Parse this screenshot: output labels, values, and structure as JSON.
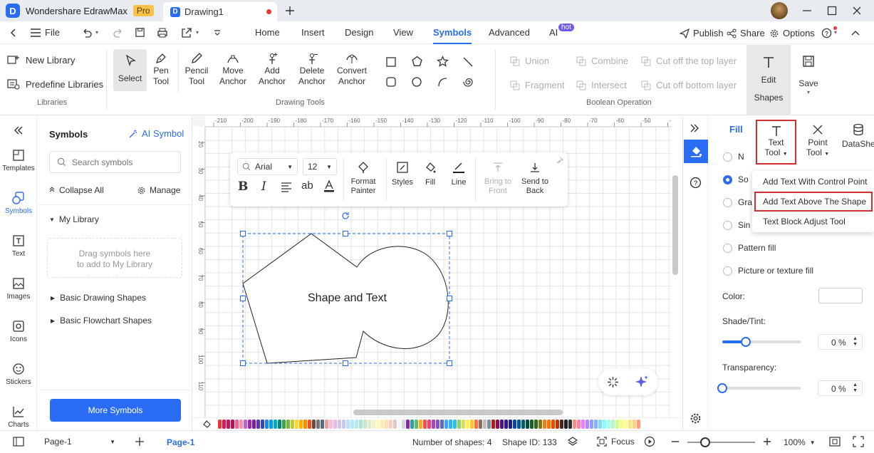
{
  "app": {
    "title": "Wondershare EdrawMax",
    "badge": "Pro",
    "doc_tab": "Drawing1"
  },
  "menu": {
    "file": "File",
    "tabs": [
      "Home",
      "Insert",
      "Design",
      "View",
      "Symbols",
      "Advanced",
      "AI"
    ],
    "ai_badge": "hot",
    "publish": "Publish",
    "share": "Share",
    "options": "Options"
  },
  "ribbon": {
    "libraries": {
      "new_library": "New Library",
      "predefine": "Predefine Libraries",
      "group": "Libraries"
    },
    "drawing": {
      "select": "Select",
      "pen": [
        "Pen",
        "Tool"
      ],
      "pencil": [
        "Pencil",
        "Tool"
      ],
      "move_anchor": [
        "Move",
        "Anchor"
      ],
      "add_anchor": [
        "Add",
        "Anchor"
      ],
      "delete_anchor": [
        "Delete",
        "Anchor"
      ],
      "convert_anchor": [
        "Convert",
        "Anchor"
      ],
      "group": "Drawing Tools"
    },
    "boolean": {
      "union": "Union",
      "combine": "Combine",
      "cut_top": "Cut off the top layer",
      "fragment": "Fragment",
      "intersect": "Intersect",
      "cut_bottom": "Cut off bottom layer",
      "group": "Boolean Operation"
    },
    "edit_shapes": [
      "Edit",
      "Shapes"
    ],
    "save": "Save"
  },
  "rail": [
    "Templates",
    "Symbols",
    "Text",
    "Images",
    "Icons",
    "Stickers",
    "Charts"
  ],
  "symbols_panel": {
    "title": "Symbols",
    "ai_symbol": "AI Symbol",
    "search_placeholder": "Search symbols",
    "collapse_all": "Collapse All",
    "manage": "Manage",
    "my_library": "My Library",
    "drop_hint": [
      "Drag symbols here",
      "to add to My Library"
    ],
    "libs": [
      "Basic Drawing Shapes",
      "Basic Flowchart Shapes"
    ],
    "more_symbols": "More Symbols"
  },
  "ruler": {
    "h": [
      "-210",
      "-200",
      "-190",
      "-180",
      "-170",
      "-160",
      "-150",
      "-140",
      "-130",
      "-120",
      "-110",
      "-100",
      "-90",
      "-80",
      "-70",
      "-60",
      "-50",
      "-40",
      "-30",
      "-20",
      "-10",
      "-4"
    ],
    "v": [
      "20",
      "30",
      "40",
      "50",
      "60",
      "70",
      "80",
      "90",
      "100",
      "110"
    ]
  },
  "floating_toolbar": {
    "font": "Arial",
    "size": "12",
    "format_painter": [
      "Format",
      "Painter"
    ],
    "styles": "Styles",
    "fill": "Fill",
    "line": "Line",
    "bring_front": [
      "Bring to",
      "Front"
    ],
    "send_back": [
      "Send to",
      "Back"
    ]
  },
  "shape_text": "Shape and Text",
  "right_panel": {
    "fill_tab": "Fill",
    "text_tool": [
      "Text",
      "Tool"
    ],
    "point_tool": [
      "Point",
      "Tool"
    ],
    "datasheet": "DataShe",
    "fill_options": [
      "N",
      "So",
      "Gra",
      "Sin",
      "Pattern fill",
      "Picture or texture fill"
    ],
    "color_label": "Color:",
    "shade_label": "Shade/Tint:",
    "shade_value": "0 %",
    "transparency_label": "Transparency:",
    "transparency_value": "0 %",
    "shade_level": 0.3,
    "transparency_level": 0
  },
  "text_menu": [
    "Add Text With Control Point",
    "Add Text Above The Shape",
    "Text Block Adjust Tool"
  ],
  "status": {
    "page_select": "Page-1",
    "page_tab": "Page-1",
    "num_shapes": "Number of shapes: 4",
    "shape_id": "Shape ID: 133",
    "focus": "Focus",
    "zoom": "100%"
  },
  "palette": [
    "#e53935",
    "#d81b60",
    "#c2185b",
    "#ad1457",
    "#f06292",
    "#f48fb1",
    "#ba68c8",
    "#9c27b0",
    "#7b1fa2",
    "#5e35b1",
    "#3949ab",
    "#1e88e5",
    "#039be5",
    "#00acc1",
    "#00897b",
    "#43a047",
    "#7cb342",
    "#c0ca33",
    "#fdd835",
    "#ffb300",
    "#fb8c00",
    "#f4511e",
    "#6d4c41",
    "#757575",
    "#546e7a",
    "#ef9a9a",
    "#f8bbd0",
    "#e1bee7",
    "#d1c4e9",
    "#c5cae9",
    "#bbdefb",
    "#b3e5fc",
    "#b2ebf2",
    "#b2dfdb",
    "#c8e6c9",
    "#dcedc8",
    "#f0f4c3",
    "#fff9c4",
    "#ffecb3",
    "#ffe0b2",
    "#ffccbc",
    "#d7ccc8",
    "#f5f5f5",
    "#cfd8dc",
    "#8e24aa",
    "#26a69a",
    "#66bb6a",
    "#ffa726",
    "#ef5350",
    "#ec407a",
    "#ab47bc",
    "#7e57c2",
    "#5c6bc0",
    "#42a5f5",
    "#29b6f6",
    "#26c6da",
    "#9ccc65",
    "#d4e157",
    "#ffee58",
    "#ffca28",
    "#ff7043",
    "#8d6e63",
    "#bdbdbd",
    "#78909c",
    "#b71c1c",
    "#880e4f",
    "#4a148c",
    "#311b92",
    "#1a237e",
    "#0d47a1",
    "#01579b",
    "#006064",
    "#004d40",
    "#1b5e20",
    "#33691e",
    "#827717",
    "#f57f17",
    "#ff6f00",
    "#e65100",
    "#bf360c",
    "#3e2723",
    "#212121",
    "#263238",
    "#ff8a80",
    "#ff80ab",
    "#ea80fc",
    "#b388ff",
    "#8c9eff",
    "#82b1ff",
    "#80d8ff",
    "#84ffff",
    "#a7ffeb",
    "#b9f6ca",
    "#ccff90",
    "#f4ff81",
    "#ffff8d",
    "#ffe57f",
    "#ffd180",
    "#ff9e80"
  ]
}
